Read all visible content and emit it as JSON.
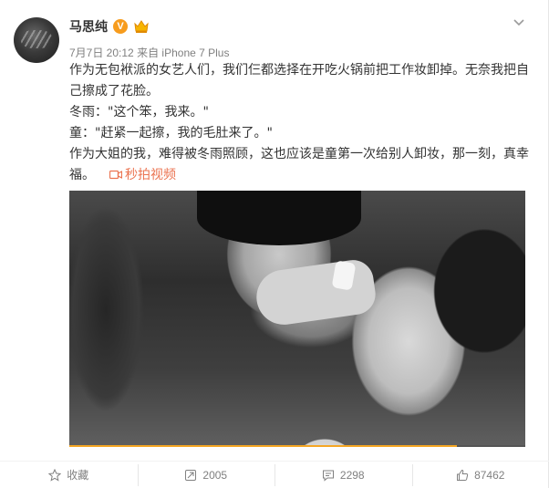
{
  "post": {
    "author": {
      "name": "马思纯",
      "verified_badge": "V",
      "avatar_icon": "avatar"
    },
    "meta": {
      "time": "7月7日 20:12",
      "from_label": "来自",
      "device": "iPhone 7 Plus"
    },
    "text": {
      "para1": "作为无包袱派的女艺人们，我们仨都选择在开吃火锅前把工作妆卸掉。无奈我把自己擦成了花脸。",
      "para2": "冬雨：\"这个笨，我来。\"",
      "para3": "童：\"赶紧一起擦，我的毛肚来了。\"",
      "para4": "作为大姐的我，难得被冬雨照顾，这也应该是童第一次给别人卸妆，那一刻，真幸福。",
      "video_link": "秒拍视频",
      "video_link_icon": "video-icon"
    },
    "video": {
      "progress": 0.85
    }
  },
  "actions": {
    "favorite": {
      "label": "收藏",
      "icon": "star-icon"
    },
    "repost": {
      "label": "2005",
      "icon": "repost-icon"
    },
    "comment": {
      "label": "2298",
      "icon": "comment-icon"
    },
    "like": {
      "label": "87462",
      "icon": "thumbs-up-icon"
    }
  },
  "colors": {
    "link": "#eb7350",
    "badge": "#f79c1d",
    "meta_text": "#808080",
    "progress": "#f5a623"
  }
}
